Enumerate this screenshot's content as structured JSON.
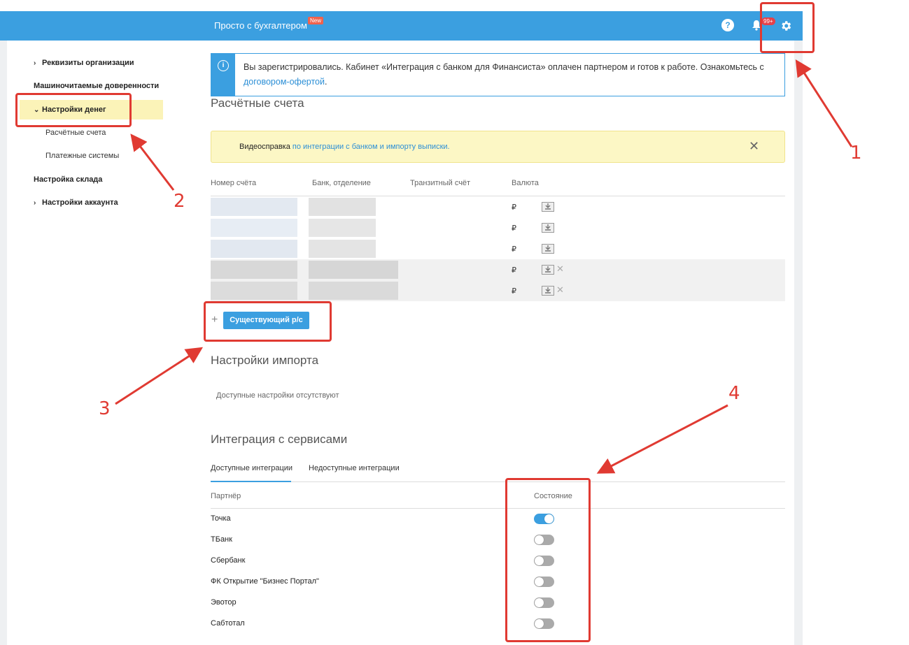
{
  "header": {
    "brand": "Просто с бухгалтером",
    "new_badge": "New",
    "help_label": "?",
    "notifications_count": "99+",
    "accent_color": "#3b9fe0"
  },
  "sidebar": {
    "items": [
      {
        "label": "Реквизиты организации",
        "expandable": true
      },
      {
        "label": "Машиночитаемые доверенности",
        "expandable": false
      },
      {
        "label": "Настройки денег",
        "expandable": true,
        "expanded": true,
        "active": true
      },
      {
        "label": "Расчётные счета",
        "sub": true
      },
      {
        "label": "Платежные системы",
        "sub": true
      },
      {
        "label": "Настройка склада",
        "expandable": false
      },
      {
        "label": "Настройки аккаунта",
        "expandable": true
      }
    ]
  },
  "info_banner": {
    "icon": "info-icon",
    "text": "Вы зарегистрировались. Кабинет «Интеграция с банком для Финансиста» оплачен партнером и готов к работе. Ознакомьтесь с ",
    "link": "договором-офертой",
    "tail": "."
  },
  "accounts": {
    "title": "Расчётные счета",
    "help_prefix": "Видеосправка ",
    "help_link": "по интеграции с банком и импорту выписки.",
    "columns": [
      "Номер счёта",
      "Банк, отделение",
      "Транзитный счёт",
      "Валюта"
    ],
    "rows": [
      {
        "currency": "₽",
        "removable": false
      },
      {
        "currency": "₽",
        "removable": false
      },
      {
        "currency": "₽",
        "removable": false
      },
      {
        "currency": "₽",
        "removable": true
      },
      {
        "currency": "₽",
        "removable": true
      }
    ],
    "add_symbol": "+",
    "add_button": "Существующий р/с"
  },
  "import": {
    "title": "Настройки импорта",
    "empty": "Доступные настройки отсутствуют"
  },
  "integrations": {
    "title": "Интеграция с сервисами",
    "tabs": [
      "Доступные интеграции",
      "Недоступные интеграции"
    ],
    "active_tab": 0,
    "columns": [
      "Партнёр",
      "Состояние"
    ],
    "partners": [
      {
        "name": "Точка",
        "enabled": true
      },
      {
        "name": "ТБанк",
        "enabled": false
      },
      {
        "name": "Сбербанк",
        "enabled": false
      },
      {
        "name": "ФК Открытие \"Бизнес Портал\"",
        "enabled": false
      },
      {
        "name": "Эвотор",
        "enabled": false
      },
      {
        "name": "Сабтотал",
        "enabled": false
      }
    ]
  },
  "annotations": {
    "labels": [
      "1",
      "2",
      "3",
      "4"
    ],
    "color": "#e03a32"
  }
}
